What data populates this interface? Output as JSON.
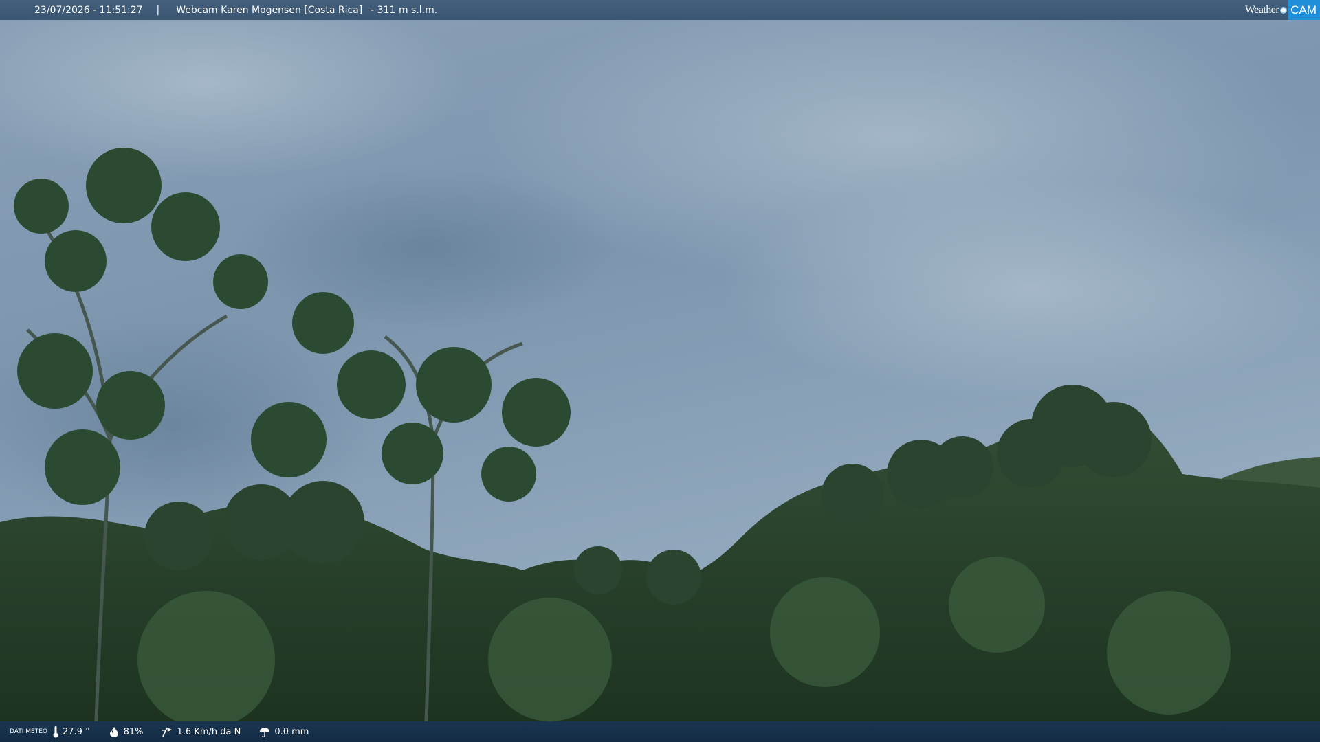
{
  "header": {
    "datetime": "23/07/2026 - 11:51:27",
    "separator": "|",
    "title": "Webcam Karen Mogensen [Costa Rica]",
    "altitude": "- 311 m s.l.m.",
    "logo_left": "Weather",
    "logo_right": "CAM"
  },
  "weather": {
    "label": "DATI METEO",
    "temperature": "27.9 °",
    "humidity": "81%",
    "wind": "1.6 Km/h da N",
    "rain": "0.0 mm"
  },
  "icons": {
    "temperature": "thermometer-icon",
    "humidity": "humidity-icon",
    "wind": "wind-icon",
    "rain": "rain-icon"
  },
  "colors": {
    "topbar": "#3f5b77",
    "bottombar": "#17304a",
    "logo_accent": "#1f8fdc",
    "sky": "#8ea6bd",
    "forest": "#2f4a2a"
  }
}
